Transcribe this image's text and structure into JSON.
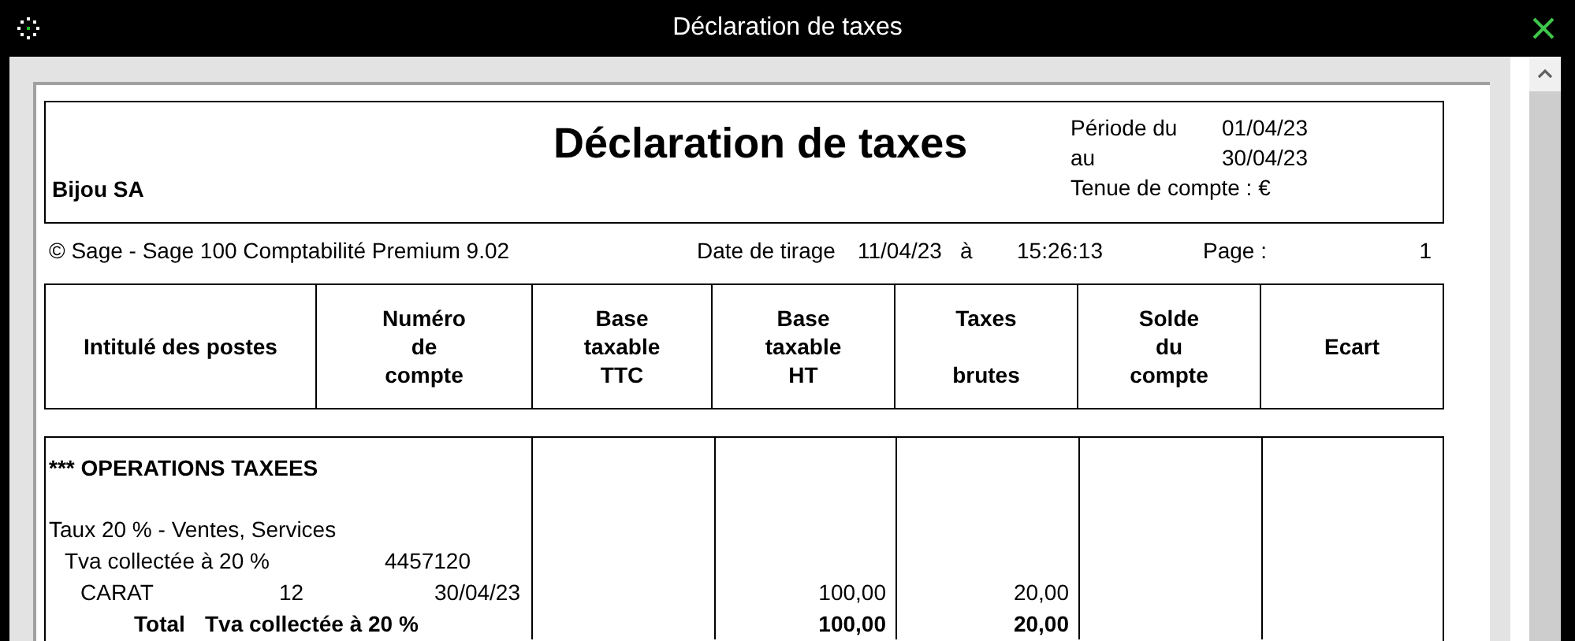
{
  "window": {
    "title": "Déclaration de taxes"
  },
  "report": {
    "title": "Déclaration de taxes",
    "company": "Bijou SA",
    "period": [
      {
        "label": "Période du",
        "value": "01/04/23"
      },
      {
        "label": "au",
        "value": "30/04/23"
      }
    ],
    "currency": "Tenue de compte : €",
    "software": "© Sage - Sage 100 Comptabilité Premium 9.02",
    "print_date_label": "Date de tirage",
    "print_date": "11/04/23",
    "at_label": "à",
    "print_time": "15:26:13",
    "page_label": "Page :",
    "page_number": "1"
  },
  "columns": [
    "Intitulé des postes",
    "Numéro\nde\ncompte",
    "Base\ntaxable\nTTC",
    "Base\ntaxable\nHT",
    "Taxes\n\nbrutes",
    "Solde\ndu\ncompte",
    "Ecart"
  ],
  "rows": [
    {
      "kind": "section",
      "label": "*** OPERATIONS TAXEES"
    },
    {
      "kind": "group",
      "label": "Taux 20 % - Ventes, Services"
    },
    {
      "kind": "account",
      "label": "Tva collectée à 20 %",
      "account": "4457120"
    },
    {
      "kind": "entry",
      "label": "CARAT",
      "piece": "12",
      "date": "30/04/23",
      "base_ht": "100,00",
      "taxes": "20,00"
    },
    {
      "kind": "total",
      "prefix": "Total",
      "label": "Tva collectée à 20 %",
      "base_ht": "100,00",
      "taxes": "20,00"
    }
  ]
}
